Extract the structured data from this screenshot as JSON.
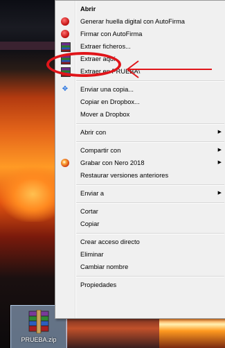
{
  "menu": {
    "items": [
      {
        "label": "Abrir",
        "bold": true,
        "icon": "none"
      },
      {
        "label": "Generar huella digital con AutoFirma",
        "icon": "autofirma-icon"
      },
      {
        "label": "Firmar con AutoFirma",
        "icon": "autofirma-icon"
      },
      {
        "label": "Extraer ficheros...",
        "icon": "winrar-icon"
      },
      {
        "label": "Extraer aquí",
        "icon": "winrar-icon"
      },
      {
        "label": "Extraer en PRUEBA\\",
        "icon": "winrar-icon"
      },
      {
        "label": "Enviar una copia...",
        "icon": "dropbox-icon"
      },
      {
        "label": "Copiar en Dropbox..."
      },
      {
        "label": "Mover a Dropbox"
      },
      {
        "label": "Abrir con",
        "submenu": true
      },
      {
        "label": "Compartir con",
        "submenu": true
      },
      {
        "label": "Grabar con Nero 2018",
        "submenu": true,
        "icon": "nero-icon"
      },
      {
        "label": "Restaurar versiones anteriores"
      },
      {
        "label": "Enviar a",
        "submenu": true
      },
      {
        "label": "Cortar"
      },
      {
        "label": "Copiar"
      },
      {
        "label": "Crear acceso directo"
      },
      {
        "label": "Eliminar"
      },
      {
        "label": "Cambiar nombre"
      },
      {
        "label": "Propiedades"
      }
    ],
    "submenu_arrow": "▶"
  },
  "desktop": {
    "file_label": "PRUEBA.zip"
  },
  "annotation": {
    "highlight_color": "#e0151a",
    "highlighted_item": "Extraer aquí"
  }
}
